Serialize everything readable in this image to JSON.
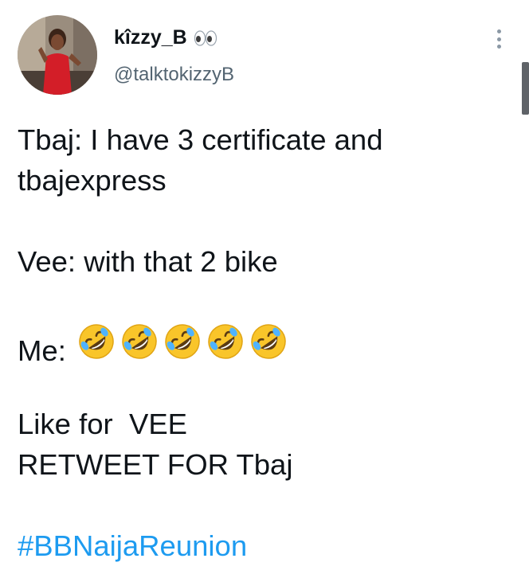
{
  "author": {
    "display_name": "kîzzy_B",
    "handle": "@talktokizzyB",
    "name_emoji_icon": "eyes-icon"
  },
  "header": {
    "more_icon": "more-vertical-icon"
  },
  "tweet": {
    "line1": "Tbaj: I have 3 certificate and",
    "line2": "tbajexpress",
    "line3": "Vee: with that 2 bike",
    "line4_prefix": "Me:",
    "line4_emoji": "rolling-on-floor-laughing-icon",
    "line4_emoji_count": 5,
    "line5": "Like for  VEE",
    "line6": "RETWEET FOR Tbaj",
    "hashtag": "#BBNaijaReunion"
  },
  "colors": {
    "text": "#0f1419",
    "secondary": "#536471",
    "link": "#1d9bf0",
    "emoji_face": "#f9c52a"
  }
}
